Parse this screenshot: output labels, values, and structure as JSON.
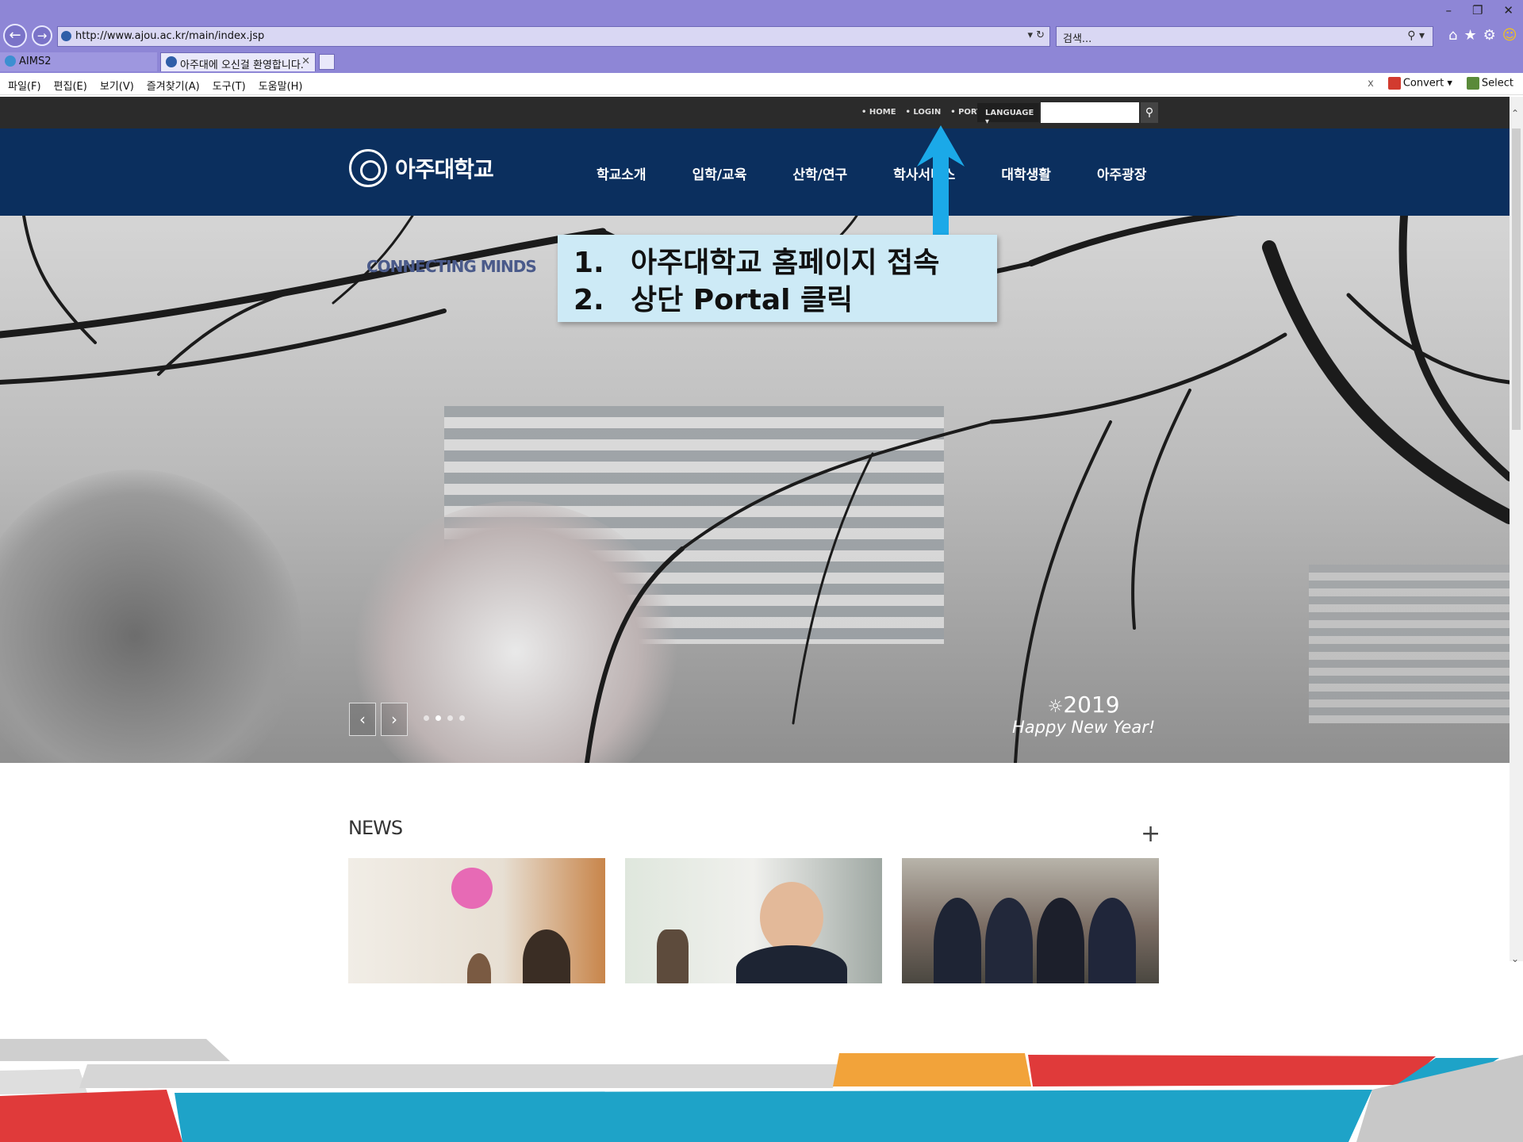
{
  "browser": {
    "address": "http://www.ajou.ac.kr/main/index.jsp",
    "search_placeholder": "검색...",
    "tabs": [
      {
        "label": "AIMS2"
      },
      {
        "label": "아주대에 오신걸 환영합니다."
      }
    ],
    "menus": [
      "파일(F)",
      "편집(E)",
      "보기(V)",
      "즐겨찾기(A)",
      "도구(T)",
      "도움말(H)"
    ],
    "toolbar_right": {
      "close": "x",
      "convert": "Convert",
      "select": "Select"
    }
  },
  "site": {
    "util_links": [
      "• HOME",
      "• LOGIN",
      "• PORTAL"
    ],
    "language": "LANGUAGE",
    "logo_text": "아주대학교",
    "nav": [
      "학교소개",
      "입학/교육",
      "산학/연구",
      "학사서비스",
      "대학생활",
      "아주광장"
    ],
    "hero": {
      "connecting_minds": "CONNECTING MINDS",
      "year": "2019",
      "message": "Happy New Year!"
    },
    "news": {
      "title": "NEWS",
      "more": "+"
    }
  },
  "callout": {
    "steps": [
      {
        "num": "1.",
        "text": "아주대학교 홈페이지 접속"
      },
      {
        "num": "2.",
        "text": "상단 Portal 클릭"
      }
    ]
  },
  "colors": {
    "chrome": "#8e86d6",
    "navy": "#0b2f5e",
    "callout_bg": "#cdeaf6",
    "arrow": "#1ba9e8"
  }
}
